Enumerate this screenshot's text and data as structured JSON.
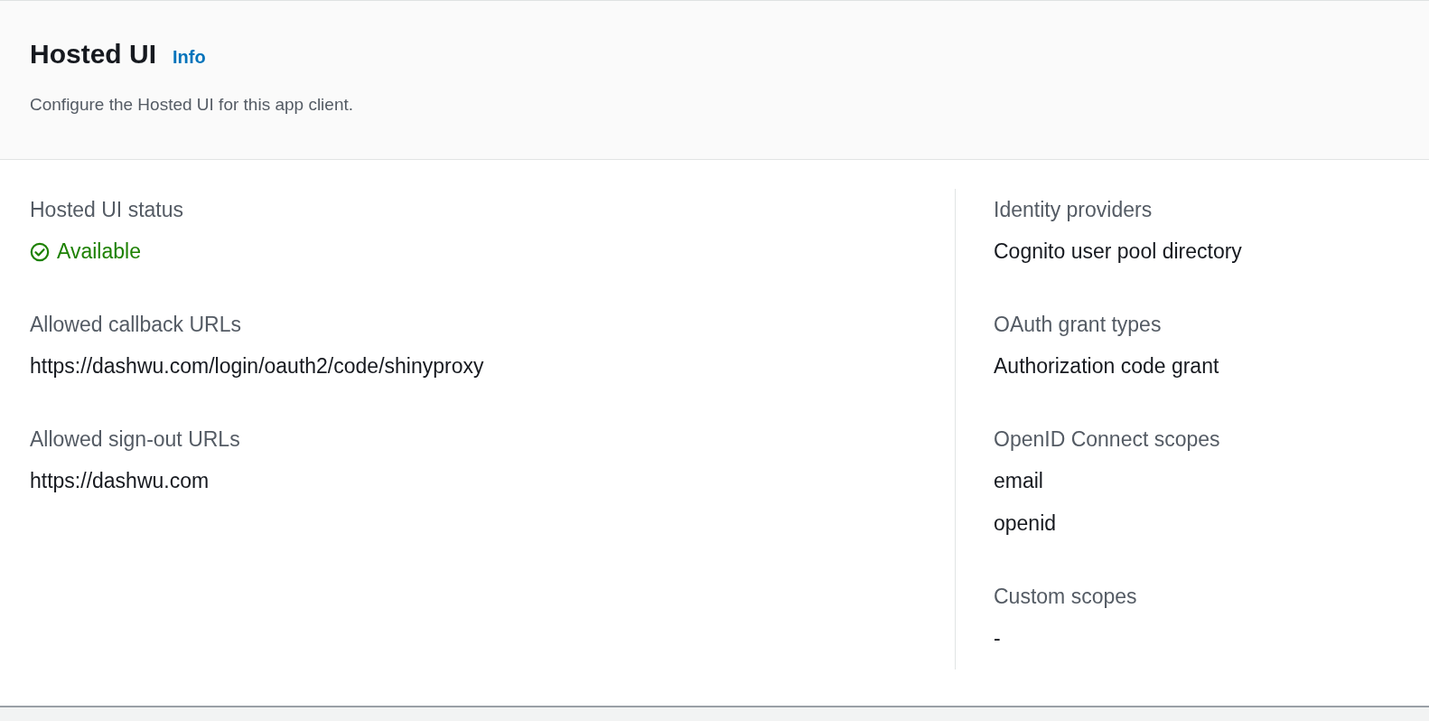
{
  "header": {
    "title": "Hosted UI",
    "info_link": "Info",
    "description": "Configure the Hosted UI for this app client."
  },
  "left": [
    {
      "label": "Hosted UI status",
      "status": {
        "text": "Available",
        "kind": "success"
      }
    },
    {
      "label": "Allowed callback URLs",
      "values": [
        "https://dashwu.com/login/oauth2/code/shinyproxy"
      ]
    },
    {
      "label": "Allowed sign-out URLs",
      "values": [
        "https://dashwu.com"
      ]
    }
  ],
  "right": [
    {
      "label": "Identity providers",
      "values": [
        "Cognito user pool directory"
      ]
    },
    {
      "label": "OAuth grant types",
      "values": [
        "Authorization code grant"
      ]
    },
    {
      "label": "OpenID Connect scopes",
      "values": [
        "email",
        "openid"
      ]
    },
    {
      "label": "Custom scopes",
      "values": [
        "-"
      ]
    }
  ]
}
